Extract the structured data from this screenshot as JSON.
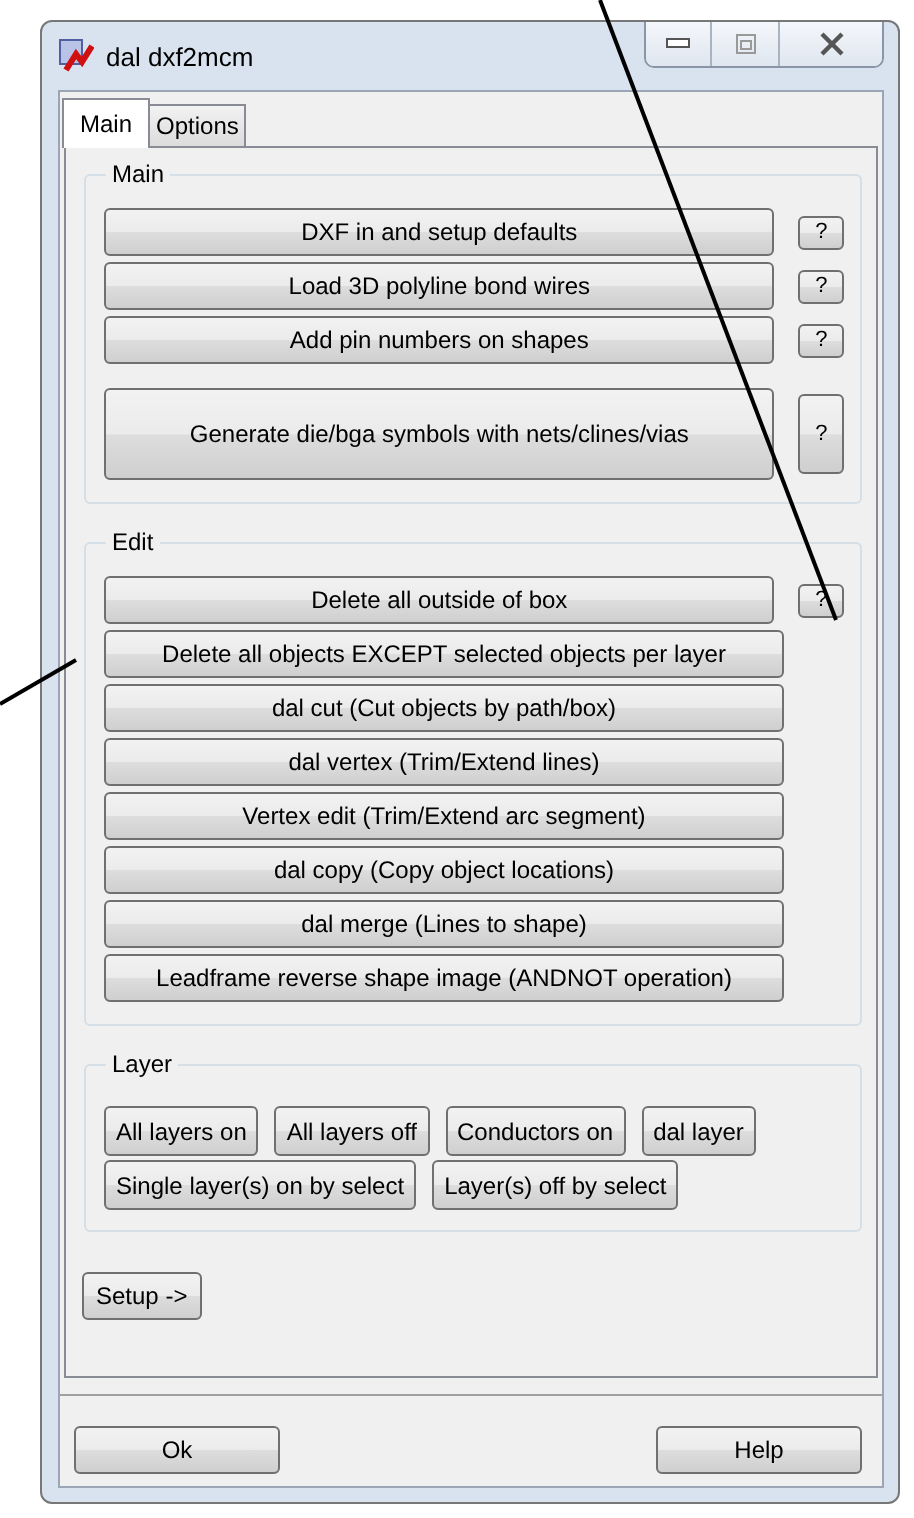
{
  "window": {
    "title": "dal dxf2mcm"
  },
  "tabs": [
    {
      "label": "Main",
      "selected": true
    },
    {
      "label": "Options",
      "selected": false
    }
  ],
  "groups": [
    {
      "title": "Main",
      "kind": "actions",
      "actions": [
        {
          "label": "DXF in and setup defaults",
          "help": "?",
          "kind": "normal"
        },
        {
          "label": "Load 3D polyline bond wires",
          "help": "?",
          "kind": "normal"
        },
        {
          "label": "Add pin numbers on shapes",
          "help": "?",
          "kind": "normal"
        },
        {
          "label": "Generate die/bga symbols with nets/clines/vias",
          "help": "?",
          "kind": "tall"
        }
      ]
    },
    {
      "title": "Edit",
      "kind": "actions",
      "actions": [
        {
          "label": "Delete all outside of box",
          "help": "?",
          "kind": "normal"
        },
        {
          "label": "Delete all objects EXCEPT selected objects per layer",
          "kind": "normal"
        },
        {
          "label": "dal cut (Cut objects by path/box)",
          "kind": "normal"
        },
        {
          "label": "dal vertex (Trim/Extend lines)",
          "kind": "normal"
        },
        {
          "label": "Vertex edit (Trim/Extend arc segment)",
          "kind": "normal"
        },
        {
          "label": "dal copy (Copy object locations)",
          "kind": "normal"
        },
        {
          "label": "dal merge (Lines to shape)",
          "kind": "normal"
        },
        {
          "label": "Leadframe reverse shape image (ANDNOT operation)",
          "kind": "normal"
        }
      ]
    },
    {
      "title": "Layer",
      "kind": "rows",
      "lines": [
        {
          "buttons": [
            "All layers on",
            "All layers off",
            "Conductors on",
            "dal layer"
          ]
        },
        {
          "buttons": [
            "Single layer(s) on by select",
            "Layer(s) off by select"
          ]
        }
      ]
    }
  ],
  "setup_button": "Setup ->",
  "footer_buttons": [
    "Ok",
    "Help"
  ]
}
